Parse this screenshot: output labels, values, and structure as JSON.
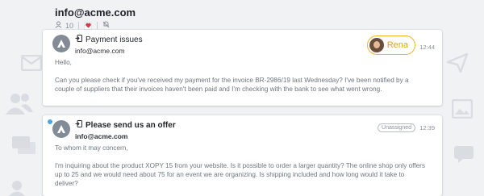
{
  "contact": {
    "email": "info@acme.com",
    "count": "10"
  },
  "messages": [
    {
      "subject": "Payment issues",
      "from": "info@acme.com",
      "assignee": "Rena",
      "time": "12:44",
      "body": [
        "Hello,",
        "Can you please check if you've received my payment for the invoice BR-2986/19 last Wednesday? I've been notified by a couple of suppliers that their invoices haven't been paid and I'm checking with the bank to see what went wrong."
      ]
    },
    {
      "subject": "Please send us an offer",
      "from": "info@acme.com",
      "status": "Unassigned",
      "time": "12:39",
      "unread": true,
      "body": [
        "To whom it may concern,",
        "I'm inquiring about the product XOPY 15 from your website. Is it possible to order a larger quantity? The online shop only offers up to 25 and we would need about 75 for an event we are organizing. Is shipping included and how long would it take to deliver?"
      ]
    }
  ],
  "colors": {
    "accent_unread": "#4aa8e0",
    "assignee_border": "#f0b429",
    "heart": "#d63a4a"
  },
  "icons": [
    "people-icon",
    "heart-icon",
    "no-notify-icon",
    "avatar-a-icon",
    "inbound-icon"
  ]
}
